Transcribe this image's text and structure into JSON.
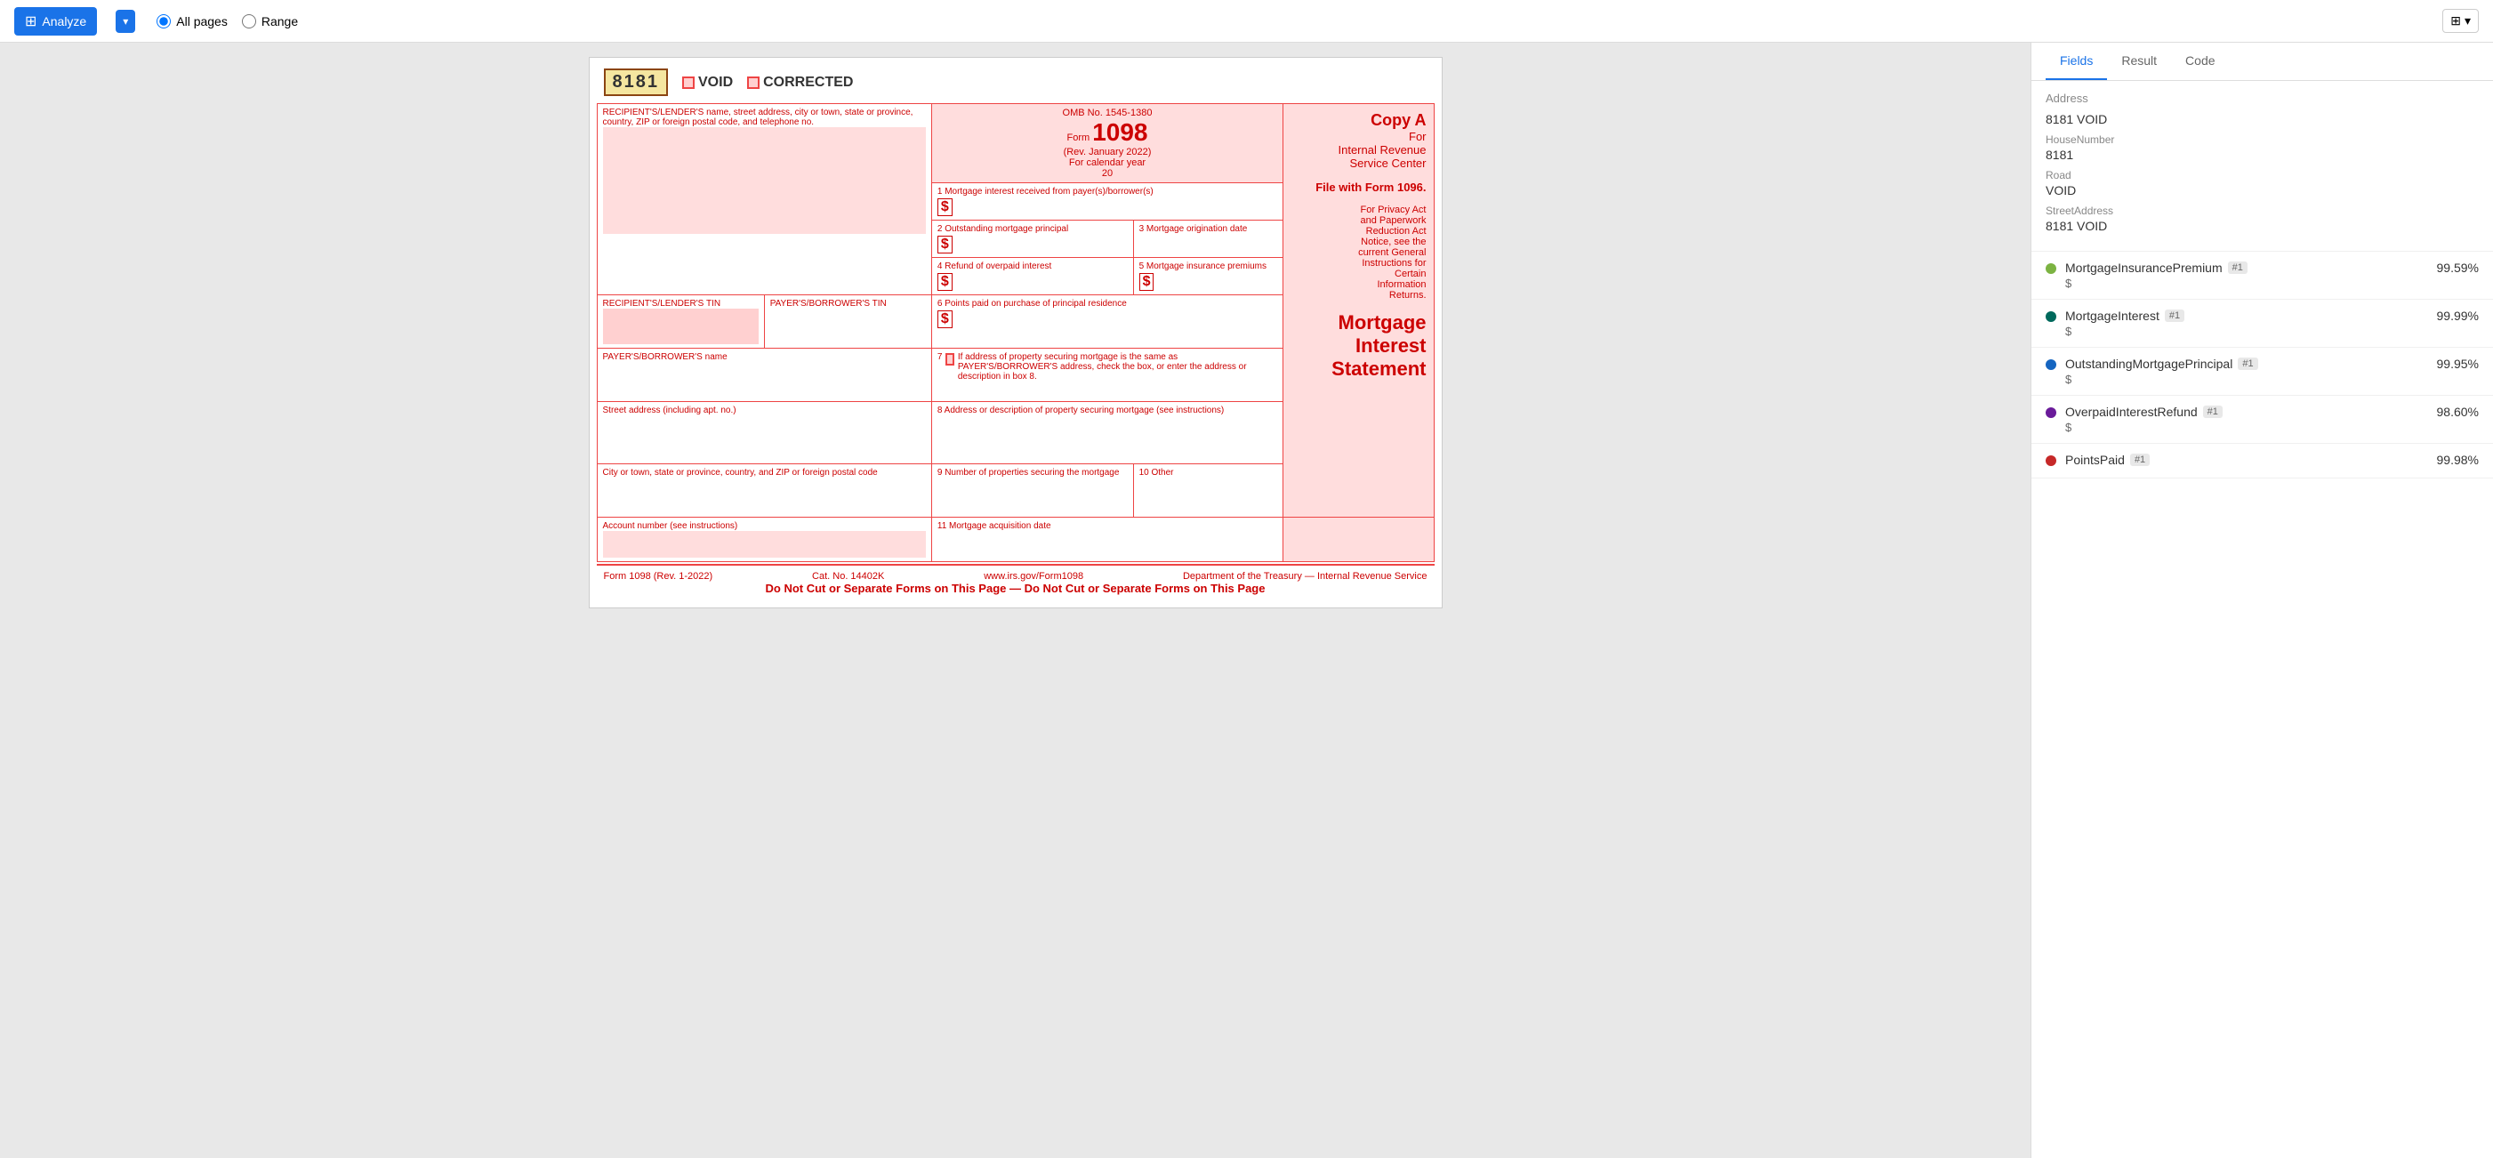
{
  "toolbar": {
    "analyze_label": "Analyze",
    "all_pages_label": "All pages",
    "range_label": "Range",
    "layers_label": "⊞",
    "dropdown_arrow": "▾"
  },
  "tabs": {
    "fields": "Fields",
    "result": "Result",
    "code": "Code",
    "active": "fields"
  },
  "form": {
    "form_id": "8181",
    "void_label": "VOID",
    "corrected_label": "CORRECTED",
    "omb": "OMB No. 1545-1380",
    "form_number": "1098",
    "rev_date": "(Rev. January 2022)",
    "calendar_year": "For calendar year",
    "calendar_year_20": "20",
    "copy_a": "Copy A",
    "for_irs": "For\nInternal Revenue\nService Center",
    "file_with": "File with Form 1096.",
    "privacy_notice": "For Privacy Act\nand Paperwork\nReduction Act\nNotice, see the\ncurrent General\nInstructions for\nCertain\nInformation\nReturns.",
    "title_line1": "Mortgage",
    "title_line2": "Interest",
    "title_line3": "Statement",
    "recipient_label": "RECIPIENT'S/LENDER'S name, street address, city or town, state or province, country, ZIP or foreign postal code, and telephone no.",
    "recipient_tin": "RECIPIENT'S/LENDER'S TIN",
    "payer_tin": "PAYER'S/BORROWER'S TIN",
    "payer_name": "PAYER'S/BORROWER'S name",
    "street_address": "Street address (including apt. no.)",
    "city_state": "City or town, state or province, country, and ZIP or foreign postal code",
    "box1_label": "1 Mortgage interest received from payer(s)/borrower(s)",
    "box2_label": "2 Outstanding mortgage principal",
    "box3_label": "3 Mortgage origination date",
    "box4_label": "4 Refund of overpaid interest",
    "box5_label": "5 Mortgage insurance premiums",
    "box6_label": "6 Points paid on purchase of principal residence",
    "box7_label": "7",
    "box7_desc": "If address of property securing mortgage is the same as PAYER'S/BORROWER'S address, check the box, or enter the address or description in box 8.",
    "box8_label": "8 Address or description of property securing mortgage (see instructions)",
    "box9_label": "9 Number of properties securing the mortgage",
    "box10_label": "10 Other",
    "box11_label": "11 Mortgage acquisition date",
    "account_label": "Account number (see instructions)",
    "form_bottom_left": "Form 1098 (Rev. 1-2022)",
    "form_bottom_cat": "Cat. No. 14402K",
    "form_bottom_url": "www.irs.gov/Form1098",
    "form_bottom_dept": "Department of the Treasury — Internal Revenue Service",
    "form_bottom_msg": "Do Not Cut or Separate Forms on This Page — Do Not Cut or Separate Forms on This Page"
  },
  "address_section": {
    "header": "Address",
    "void_label": "8181 VOID",
    "house_number_label": "HouseNumber",
    "house_number_value": "8181",
    "road_label": "Road",
    "road_value": "VOID",
    "street_address_label": "StreetAddress",
    "street_address_value": "8181 VOID"
  },
  "confidence_items": [
    {
      "name": "MortgageInsurancePremium",
      "badge": "#1",
      "value": "$",
      "pct": "99.59%",
      "color": "#7cb342"
    },
    {
      "name": "MortgageInterest",
      "badge": "#1",
      "value": "$",
      "pct": "99.99%",
      "color": "#00695c"
    },
    {
      "name": "OutstandingMortgagePrincipal",
      "badge": "#1",
      "value": "$",
      "pct": "99.95%",
      "color": "#1565c0"
    },
    {
      "name": "OverpaidInterestRefund",
      "badge": "#1",
      "value": "$",
      "pct": "98.60%",
      "color": "#6a1b9a"
    },
    {
      "name": "PointsPaid",
      "badge": "#1",
      "value": "",
      "pct": "99.98%",
      "color": "#c62828"
    }
  ]
}
